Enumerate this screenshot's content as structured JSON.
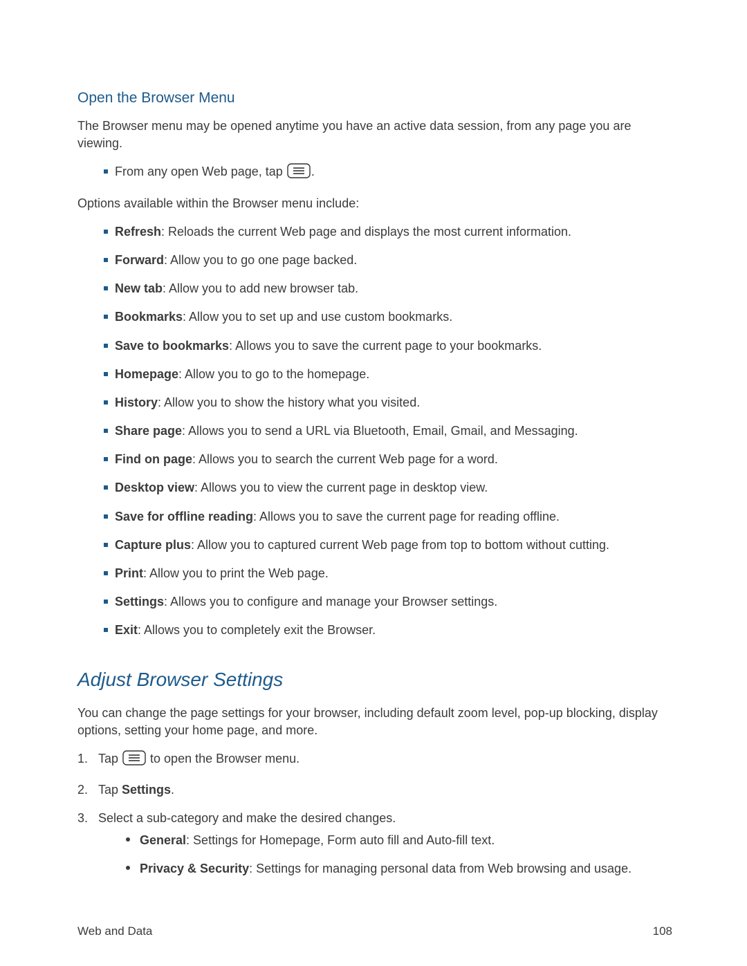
{
  "section1": {
    "heading": "Open the Browser Menu",
    "intro": "The Browser menu may be opened anytime you have an active data session, from any page you are viewing.",
    "step_pre": "From any open Web page, tap ",
    "step_post": ".",
    "available_text": "Options available within the Browser menu include:",
    "options": [
      {
        "label": "Refresh",
        "desc": ": Reloads the current Web page and displays the most current information."
      },
      {
        "label": "Forward",
        "desc": ": Allow you to go one page backed."
      },
      {
        "label": "New tab",
        "desc": ": Allow you to add new browser tab."
      },
      {
        "label": "Bookmarks",
        "desc": ": Allow you to set up and use custom bookmarks."
      },
      {
        "label": "Save to bookmarks",
        "desc": ": Allows you to save the current page to your bookmarks."
      },
      {
        "label": "Homepage",
        "desc": ": Allow you to go to the homepage."
      },
      {
        "label": "History",
        "desc": ": Allow you to show the history what you visited."
      },
      {
        "label": "Share page",
        "desc": ": Allows you to send a URL via Bluetooth, Email, Gmail, and Messaging."
      },
      {
        "label": "Find on page",
        "desc": ": Allows you to search the current Web page for a word."
      },
      {
        "label": "Desktop view",
        "desc": ": Allows you to view the current page in desktop view."
      },
      {
        "label": "Save for offline reading",
        "desc": ": Allows you to save the current page for reading offline."
      },
      {
        "label": "Capture plus",
        "desc": ": Allow you to captured current Web page from top to bottom without cutting."
      },
      {
        "label": "Print",
        "desc": ": Allow you to print the Web page."
      },
      {
        "label": "Settings",
        "desc": ": Allows you to configure and manage your Browser settings."
      },
      {
        "label": "Exit",
        "desc": ": Allows you to completely exit the Browser."
      }
    ]
  },
  "section2": {
    "heading": "Adjust Browser Settings",
    "intro": "You can change the page settings for your browser, including default zoom level, pop-up blocking, display options, setting your home page, and more.",
    "steps": {
      "s1_pre": "Tap ",
      "s1_post": " to open the Browser menu.",
      "s2_pre": "Tap ",
      "s2_bold": "Settings",
      "s2_post": ".",
      "s3": "Select a sub-category and make the desired changes."
    },
    "subcats": [
      {
        "label": "General",
        "desc": ": Settings for Homepage, Form auto fill and Auto-fill text."
      },
      {
        "label": "Privacy & Security",
        "desc": ": Settings for managing personal data from Web browsing and usage."
      }
    ]
  },
  "footer": {
    "left": "Web and Data",
    "right": "108"
  },
  "icons": {
    "menu": "menu-icon"
  }
}
